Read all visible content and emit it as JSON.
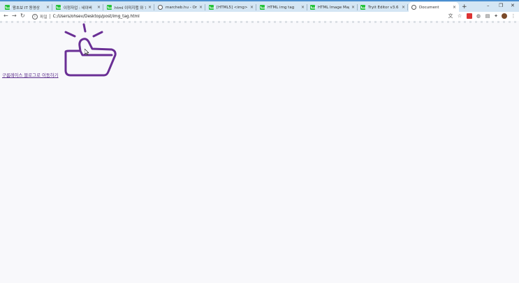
{
  "browser": {
    "tabs": [
      {
        "label": "왕초보 IT 동영상",
        "icon": "green-blog-icon"
      },
      {
        "label": "이정자업 : 네이버",
        "icon": "green-blog-icon"
      },
      {
        "label": "html 이미지맵 와 ?",
        "icon": "green-blog-icon"
      },
      {
        "label": "marcheb.hu - Onli",
        "icon": "globe-icon"
      },
      {
        "label": "[HTML5] <img> ?",
        "icon": "green-blog-icon"
      },
      {
        "label": "HTML img tag",
        "icon": "green-blog-icon"
      },
      {
        "label": "HTML Image Maps",
        "icon": "green-blog-icon"
      },
      {
        "label": "Tryit Editor v3.6",
        "icon": "green-blog-icon"
      },
      {
        "label": "Document",
        "icon": "globe-icon",
        "active": true
      }
    ],
    "address": {
      "scheme_label": "파일",
      "url": "C:/Users/ohsev/Desktop/post/img_tag.html"
    }
  },
  "page": {
    "link_text": "구름레이스 블로그로 이동하기",
    "image_icon": "thumbs-up-icon",
    "colors": {
      "link": "#5a2b8a",
      "icon_stroke": "#6a2f95"
    }
  }
}
